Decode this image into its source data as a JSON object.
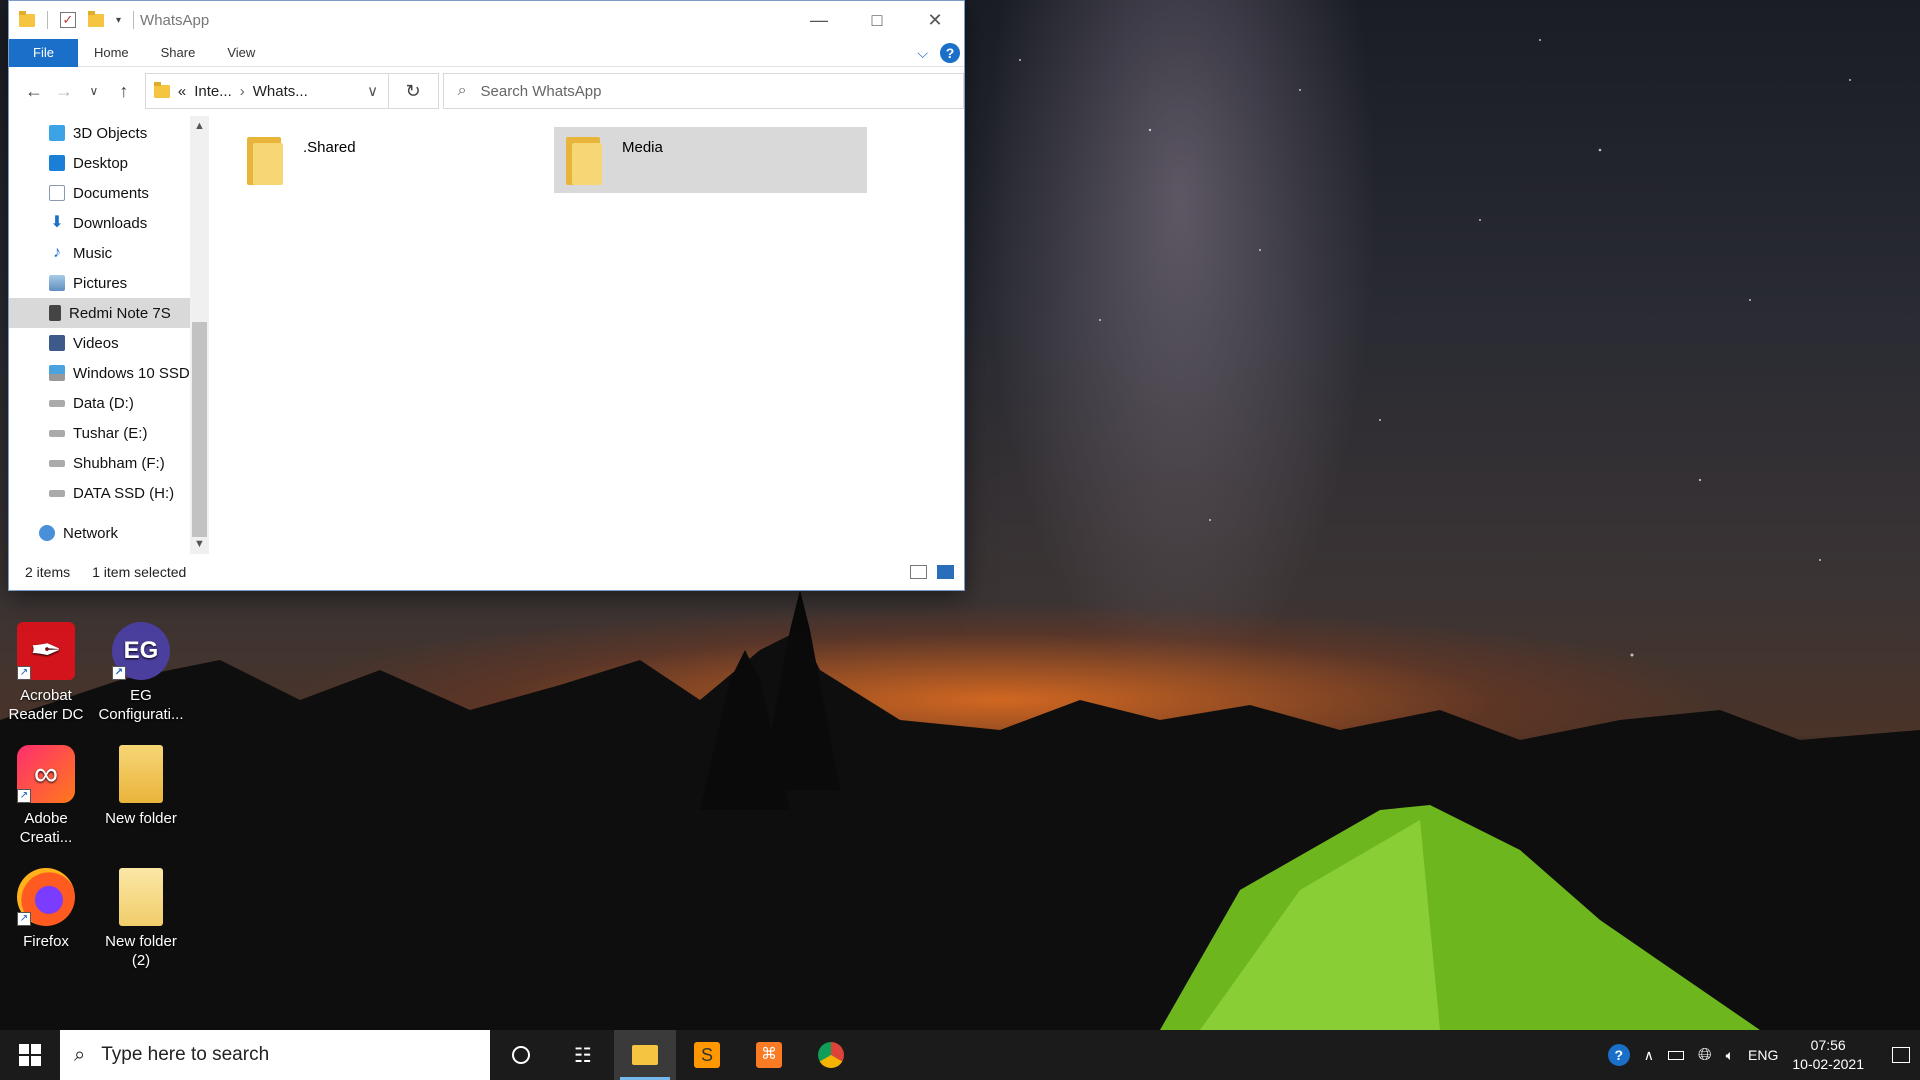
{
  "window": {
    "title": "WhatsApp",
    "ribbon_tabs": [
      "File",
      "Home",
      "Share",
      "View"
    ],
    "breadcrumb": {
      "overflow": "«",
      "segments": [
        "Inte...",
        "Whats..."
      ]
    },
    "search_placeholder": "Search WhatsApp",
    "nav_items": [
      {
        "label": "3D Objects",
        "icon": "3d-objects-icon",
        "color": "#3ba3e6"
      },
      {
        "label": "Desktop",
        "icon": "desktop-icon",
        "color": "#1a7fd6"
      },
      {
        "label": "Documents",
        "icon": "documents-icon",
        "color": "#8a9bb0"
      },
      {
        "label": "Downloads",
        "icon": "downloads-icon",
        "color": "#1a6fc9"
      },
      {
        "label": "Music",
        "icon": "music-icon",
        "color": "#1a6fc9"
      },
      {
        "label": "Pictures",
        "icon": "pictures-icon",
        "color": "#6a9ec9"
      },
      {
        "label": "Redmi Note 7S",
        "icon": "phone-icon",
        "color": "#444444",
        "selected": true
      },
      {
        "label": "Videos",
        "icon": "videos-icon",
        "color": "#3d5a8a"
      },
      {
        "label": "Windows 10 SSD",
        "icon": "drive-c-icon",
        "color": "#4aa3df"
      },
      {
        "label": "Data (D:)",
        "icon": "drive-icon",
        "color": "#888888"
      },
      {
        "label": "Tushar (E:)",
        "icon": "drive-icon",
        "color": "#888888"
      },
      {
        "label": "Shubham (F:)",
        "icon": "drive-icon",
        "color": "#888888"
      },
      {
        "label": "DATA SSD (H:)",
        "icon": "drive-icon",
        "color": "#888888"
      }
    ],
    "network_label": "Network",
    "files": [
      {
        "name": ".Shared",
        "selected": false
      },
      {
        "name": "Media",
        "selected": true
      }
    ],
    "status": {
      "count": "2 items",
      "selection": "1 item selected"
    }
  },
  "desktop_icons": [
    {
      "label": "Acrobat Reader DC",
      "icon": "acrobat-icon"
    },
    {
      "label": "EG Configurati...",
      "icon": "eg-config-icon"
    },
    {
      "label": "Adobe Creati...",
      "icon": "adobe-cc-icon"
    },
    {
      "label": "New folder",
      "icon": "folder-icon"
    },
    {
      "label": "Firefox",
      "icon": "firefox-icon"
    },
    {
      "label": "New folder (2)",
      "icon": "folder-icon"
    }
  ],
  "taskbar": {
    "search_placeholder": "Type here to search",
    "language": "ENG",
    "time": "07:56",
    "date": "10-02-2021"
  }
}
